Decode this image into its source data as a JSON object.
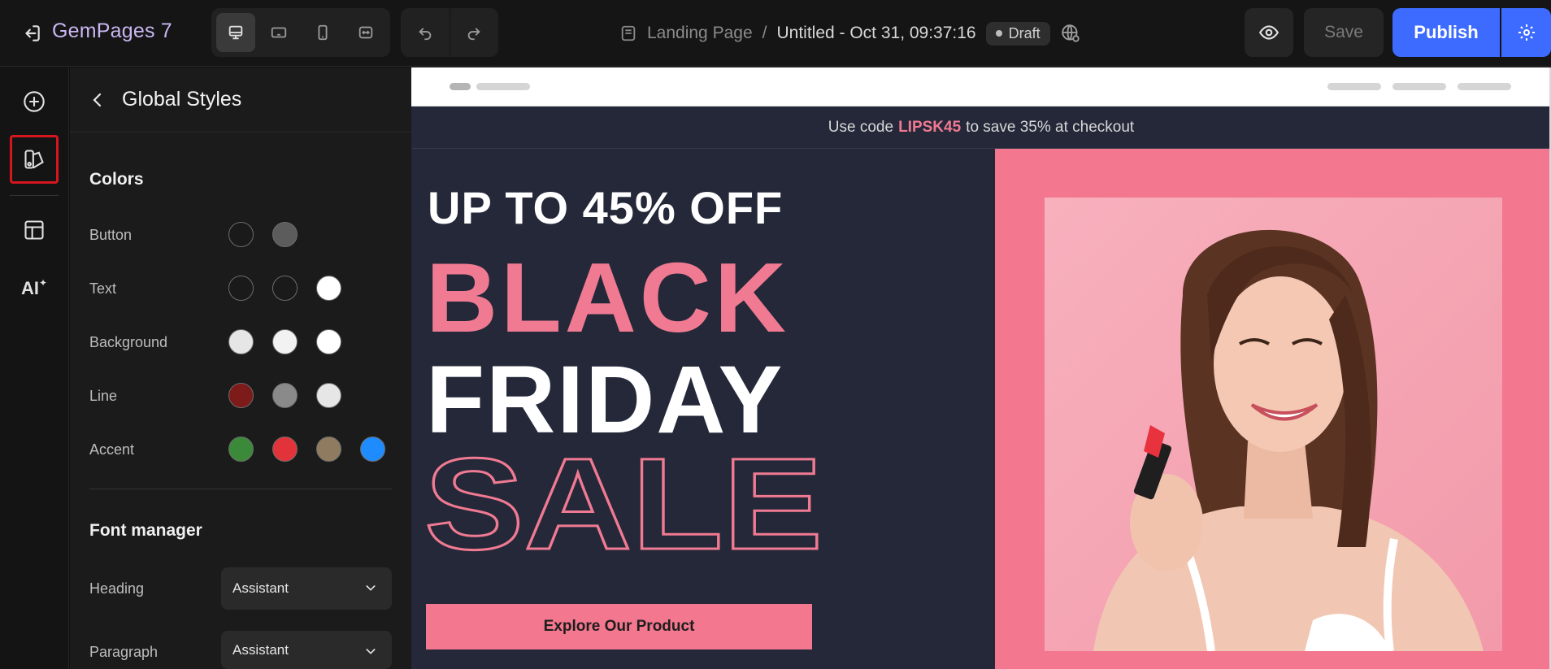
{
  "app": {
    "brand": "GemPages 7",
    "page_type": "Landing Page",
    "separator": "/",
    "page_title": "Untitled - Oct 31, 09:37:16",
    "status": "Draft",
    "save_label": "Save",
    "publish_label": "Publish"
  },
  "toolbar": {
    "devices": [
      "desktop-icon",
      "tablet-landscape-icon",
      "mobile-icon",
      "fit-width-icon"
    ],
    "active_device": "desktop-icon"
  },
  "rail": {
    "items": [
      "add-element-icon",
      "global-styles-icon",
      "layout-icon",
      "ai-icon"
    ],
    "selected": "global-styles-icon",
    "ai_label": "AI"
  },
  "panel": {
    "title": "Global Styles",
    "colors": {
      "heading": "Colors",
      "rows": [
        {
          "label": "Button",
          "swatches": [
            "#1a1a1a",
            "#5c5c5c"
          ]
        },
        {
          "label": "Text",
          "swatches": [
            "#1a1a1a",
            "#1a1a1a",
            "#ffffff"
          ]
        },
        {
          "label": "Background",
          "swatches": [
            "#e6e6e6",
            "#f2f2f2",
            "#ffffff"
          ]
        },
        {
          "label": "Line",
          "swatches": [
            "#7d1a1a",
            "#8a8a8a",
            "#e6e6e6"
          ]
        },
        {
          "label": "Accent",
          "swatches": [
            "#3a8a3a",
            "#e3333a",
            "#8f7c60",
            "#1e8cff"
          ]
        }
      ]
    },
    "fonts": {
      "heading": "Font manager",
      "rows": [
        {
          "label": "Heading",
          "value": "Assistant"
        },
        {
          "label": "Paragraph",
          "value": "Assistant"
        }
      ]
    }
  },
  "canvas": {
    "promo": {
      "prefix": "Use code",
      "code": "LIPSK45",
      "suffix": "to save 35% at checkout"
    },
    "hero": {
      "offer": "UP TO 45% OFF",
      "line1": "BLACK",
      "line2": "FRIDAY",
      "line3": "SALE",
      "cta": "Explore Our Product"
    },
    "colors": {
      "dark": "#242839",
      "pink": "#f3778e",
      "accent_text": "#f07a92"
    }
  }
}
